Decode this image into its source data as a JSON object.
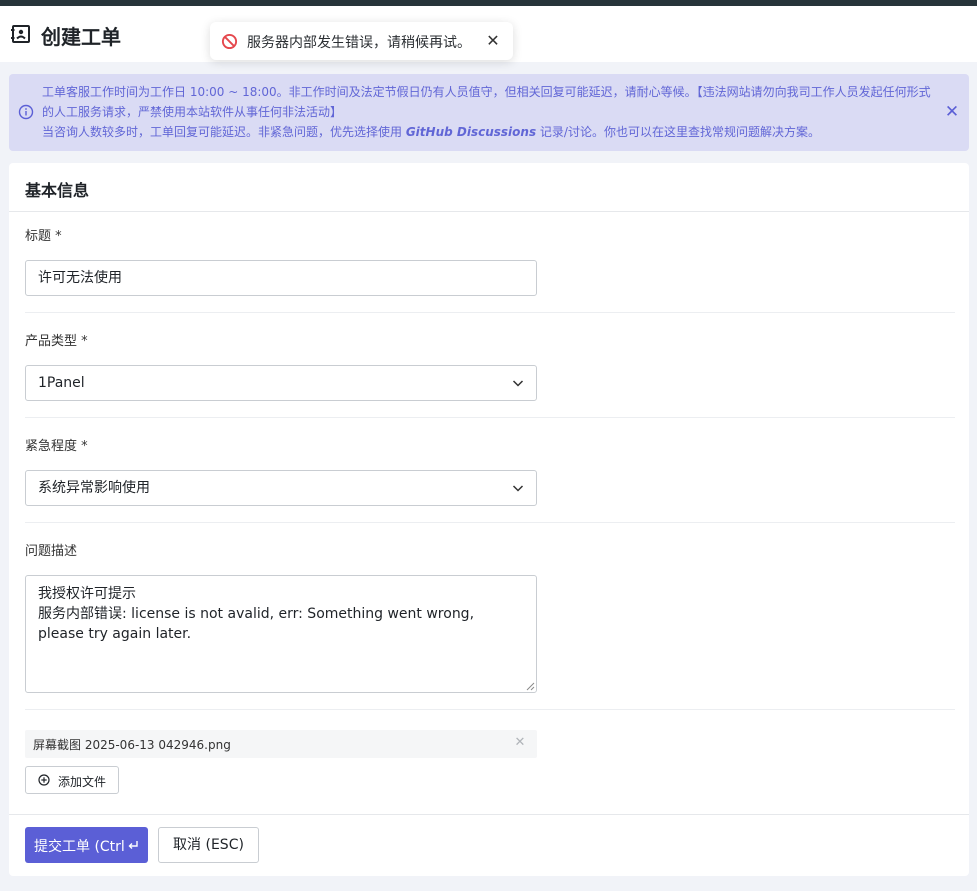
{
  "header": {
    "title": "创建工单",
    "icon": "contact-card-icon"
  },
  "toast": {
    "message": "服务器内部发生错误，请稍候再试。",
    "close": "✕",
    "icon": "prohibited-icon",
    "color": "#e5484d"
  },
  "notice": {
    "line1": "工单客服工作时间为工作日 10:00 ~ 18:00。非工作时间及法定节假日仍有人员值守，但相关回复可能延迟，请耐心等候。【违法网站请勿向我司工作人员发起任何形式的人工服务请求，严禁使用本站软件从事任何非法活动】",
    "line2_before": "当咨询人数较多时，工单回复可能延迟。非紧急问题，优先选择使用 ",
    "line2_link": "GitHub Discussions",
    "line2_after": " 记录/讨论。你也可以在这里查找常规问题解决方案。",
    "close": "✕",
    "icon": "info-icon",
    "color": "#5b5fd6"
  },
  "form": {
    "section_title": "基本信息",
    "title_label": "标题 *",
    "title_value": "许可无法使用",
    "product_label": "产品类型 *",
    "product_value": "1Panel",
    "urgency_label": "紧急程度 *",
    "urgency_value": "系统异常影响使用",
    "description_label": "问题描述",
    "description_lines": [
      "我授权许可提示",
      "服务内部错误: license is not avalid, err: Something went wrong, please try again later."
    ],
    "attachment_name": "屏幕截图 2025-06-13 042946.png",
    "attachment_remove": "✕",
    "add_file_label": "添加文件",
    "submit_label": "提交工单 (Ctrl",
    "cancel_label": "取消 (ESC)",
    "accent_color": "#5b5fd6"
  }
}
